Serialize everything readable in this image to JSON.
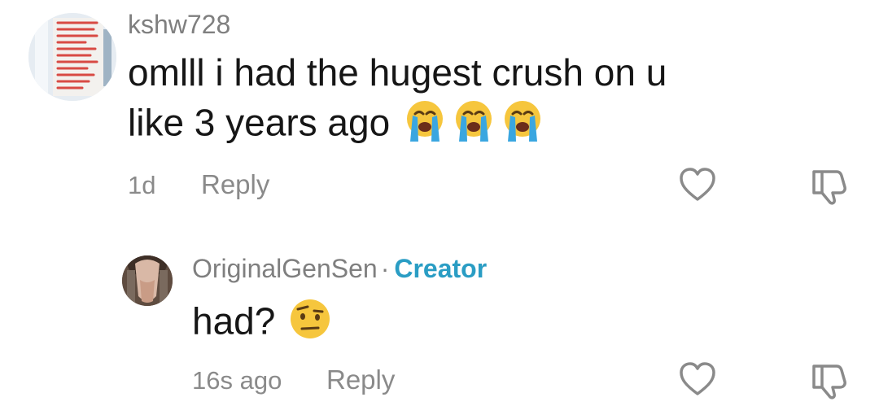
{
  "comments": [
    {
      "username": "kshw728",
      "text": "omlll i had the hugest crush on u",
      "text_line2": "like 3 years ago",
      "emoji": [
        "loudly-crying-face",
        "loudly-crying-face",
        "loudly-crying-face"
      ],
      "time": "1d",
      "reply_label": "Reply",
      "avatar_icon": "photo-of-red-sign-avatar"
    },
    {
      "username": "OriginalGenSen",
      "separator": "·",
      "badge": "Creator",
      "text": "had?",
      "emoji": [
        "face-with-raised-eyebrow"
      ],
      "time": "16s ago",
      "reply_label": "Reply",
      "avatar_icon": "photo-avatar"
    }
  ],
  "icons": {
    "like": "heart-outline-icon",
    "dislike": "thumbs-down-outline-icon"
  },
  "colors": {
    "text": "#161616",
    "muted": "#8a8a8a",
    "creator": "#2a9dc4",
    "background": "#ffffff"
  }
}
